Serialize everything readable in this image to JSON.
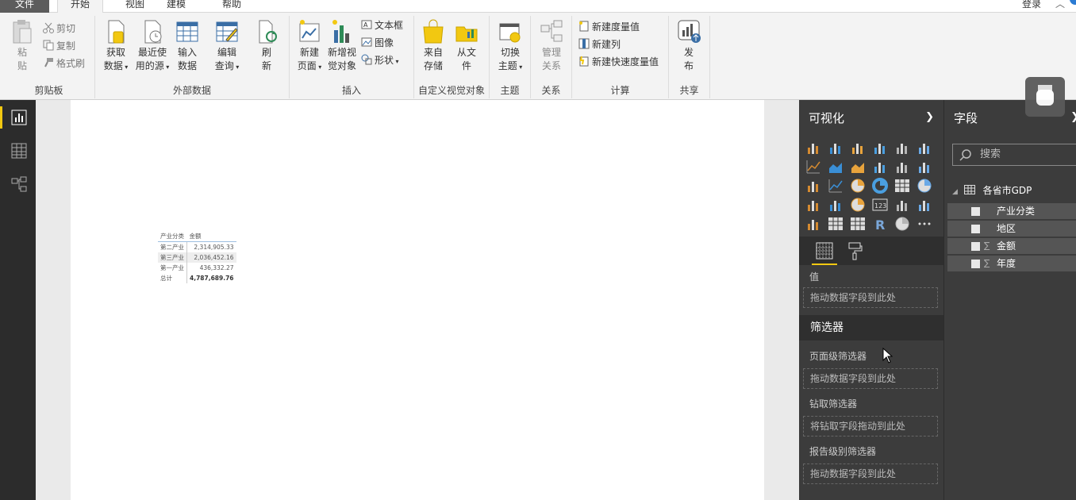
{
  "menu": {
    "file": "文件",
    "home": "开始",
    "view": "视图",
    "modeling": "建模",
    "help": "帮助",
    "login": "登录"
  },
  "ribbon": {
    "clipboard": {
      "paste": "粘",
      "paste2": "贴",
      "cut": "剪切",
      "copy": "复制",
      "format_painter": "格式刷",
      "label": "剪贴板"
    },
    "external": {
      "get_data_1": "获取",
      "get_data_2": "数据",
      "recent_1": "最近使",
      "recent_2": "用的源",
      "enter_1": "输入",
      "enter_2": "数据",
      "edit_1": "编辑",
      "edit_2": "查询",
      "refresh_1": "刷",
      "refresh_2": "新",
      "label": "外部数据"
    },
    "insert": {
      "new_page_1": "新建",
      "new_page_2": "页面",
      "new_visual_1": "新增视",
      "new_visual_2": "觉对象",
      "textbox": "文本框",
      "image": "图像",
      "shapes": "形状",
      "label": "插入"
    },
    "custom": {
      "from_store_1": "来自",
      "from_store_2": "存储",
      "from_file_1": "从文",
      "from_file_2": "件",
      "label": "自定义视觉对象"
    },
    "theme": {
      "switch_1": "切换",
      "switch_2": "主题",
      "label": "主题"
    },
    "relations": {
      "manage_1": "管理",
      "manage_2": "关系",
      "label": "关系"
    },
    "calc": {
      "new_measure": "新建度量值",
      "new_column": "新建列",
      "new_quick_measure": "新建快速度量值",
      "label": "计算"
    },
    "share": {
      "publish_1": "发",
      "publish_2": "布",
      "label": "共享"
    }
  },
  "matrix": {
    "headers": [
      "产业分类",
      "金额"
    ],
    "rows": [
      [
        "第二产业",
        "2,314,905.33"
      ],
      [
        "第三产业",
        "2,036,452.16"
      ],
      [
        "第一产业",
        "436,332.27"
      ]
    ],
    "total": [
      "总计",
      "4,787,689.76"
    ]
  },
  "viz_pane": {
    "title": "可视化",
    "values_label": "值",
    "values_drop": "拖动数据字段到此处",
    "filters_title": "筛选器",
    "page_filters": "页面级筛选器",
    "page_drop": "拖动数据字段到此处",
    "drill_filters": "钻取筛选器",
    "drill_drop": "将钻取字段拖动到此处",
    "report_filters": "报告级别筛选器",
    "report_drop": "拖动数据字段到此处"
  },
  "fields_pane": {
    "title": "字段",
    "search_placeholder": "搜索",
    "table_name": "各省市GDP",
    "fields": [
      {
        "name": "产业分类",
        "sigma": ""
      },
      {
        "name": "地区",
        "sigma": ""
      },
      {
        "name": "金额",
        "sigma": "∑"
      },
      {
        "name": "年度",
        "sigma": "∑"
      }
    ]
  },
  "colors": {
    "accent": "#f2c811",
    "pane_bg": "#3c3c3c",
    "leftbar_bg": "#2c2c2c"
  }
}
